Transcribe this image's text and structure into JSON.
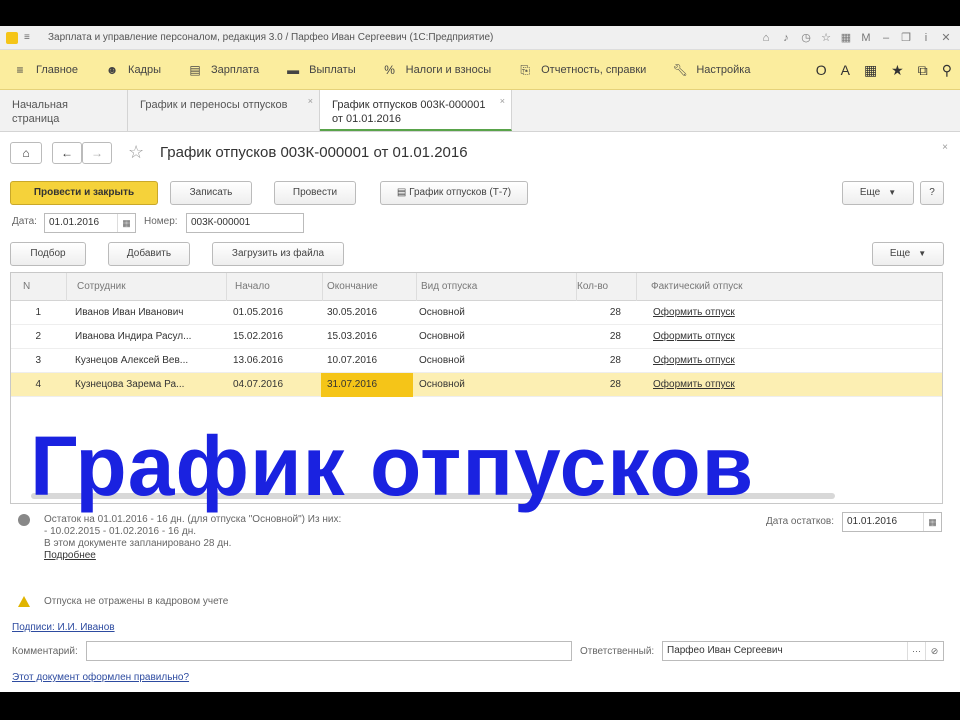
{
  "window": {
    "title": "Зарплата и управление персоналом, редакция 3.0 / Парфео Иван Сергеевич  (1С:Предприятие)"
  },
  "main_menu": [
    {
      "icon": "menu-icon",
      "label": "Главное"
    },
    {
      "icon": "people-icon",
      "label": "Кадры"
    },
    {
      "icon": "calculator-icon",
      "label": "Зарплата"
    },
    {
      "icon": "wallet-icon",
      "label": "Выплаты"
    },
    {
      "icon": "percent-icon",
      "label": "Налоги и взносы"
    },
    {
      "icon": "report-icon",
      "label": "Отчетность, справки"
    },
    {
      "icon": "wrench-icon",
      "label": "Настройка"
    }
  ],
  "main_menu_right_label": "А",
  "tabs": [
    {
      "label": "Начальная страница"
    },
    {
      "label": "График и переносы отпусков"
    },
    {
      "label": "График отпусков 003К-000001\nот 01.01.2016"
    }
  ],
  "form": {
    "title": "График отпусков 003К-000001 от 01.01.2016",
    "buttons": {
      "post_close": "Провести и закрыть",
      "save": "Записать",
      "post": "Провести",
      "print": "График отпусков (Т-7)",
      "more": "Еще",
      "help": "?"
    },
    "date_label": "Дата:",
    "date_value": "01.01.2016",
    "number_label": "Номер:",
    "number_value": "003К-000001"
  },
  "table_toolbar": {
    "select": "Подбор",
    "add": "Добавить",
    "load": "Загрузить из файла",
    "more": "Еще"
  },
  "table": {
    "columns": [
      "N",
      "Сотрудник",
      "Начало",
      "Окончание",
      "Вид отпуска",
      "Кол-во",
      "Фактический отпуск"
    ],
    "rows": [
      {
        "n": "1",
        "employee": "Иванов Иван Иванович",
        "start": "01.05.2016",
        "end": "30.05.2016",
        "kind": "Основной",
        "days": "28",
        "actual": "Оформить отпуск"
      },
      {
        "n": "2",
        "employee": "Иванова Индира Расул...",
        "start": "15.02.2016",
        "end": "15.03.2016",
        "kind": "Основной",
        "days": "28",
        "actual": "Оформить отпуск"
      },
      {
        "n": "3",
        "employee": "Кузнецов Алексей Вев...",
        "start": "13.06.2016",
        "end": "10.07.2016",
        "kind": "Основной",
        "days": "28",
        "actual": "Оформить отпуск"
      },
      {
        "n": "4",
        "employee": "Кузнецова Зарема Ра...",
        "start": "04.07.2016",
        "end": "31.07.2016",
        "kind": "Основной",
        "days": "28",
        "actual": "Оформить отпуск"
      }
    ]
  },
  "overlay_title": "График отпусков",
  "info": {
    "lines": [
      "Остаток на 01.01.2016 - 16 дн. (для отпуска \"Основной\") Из них:",
      "- 10.02.2015 - 01.02.2016 - 16 дн.",
      "В этом документе запланировано 28 дн."
    ],
    "details_link": "Подробнее",
    "balance_date_label": "Дата остатков:",
    "balance_date_value": "01.01.2016",
    "warning": "Отпуска не отражены в кадровом учете"
  },
  "footer": {
    "signer_link": "Подписи: И.И. Иванов",
    "comment_label": "Комментарий:",
    "comment_value": "",
    "responsible_label": "Ответственный:",
    "responsible_value": "Парфео Иван Сергеевич",
    "help_link": "Этот документ оформлен правильно?"
  }
}
